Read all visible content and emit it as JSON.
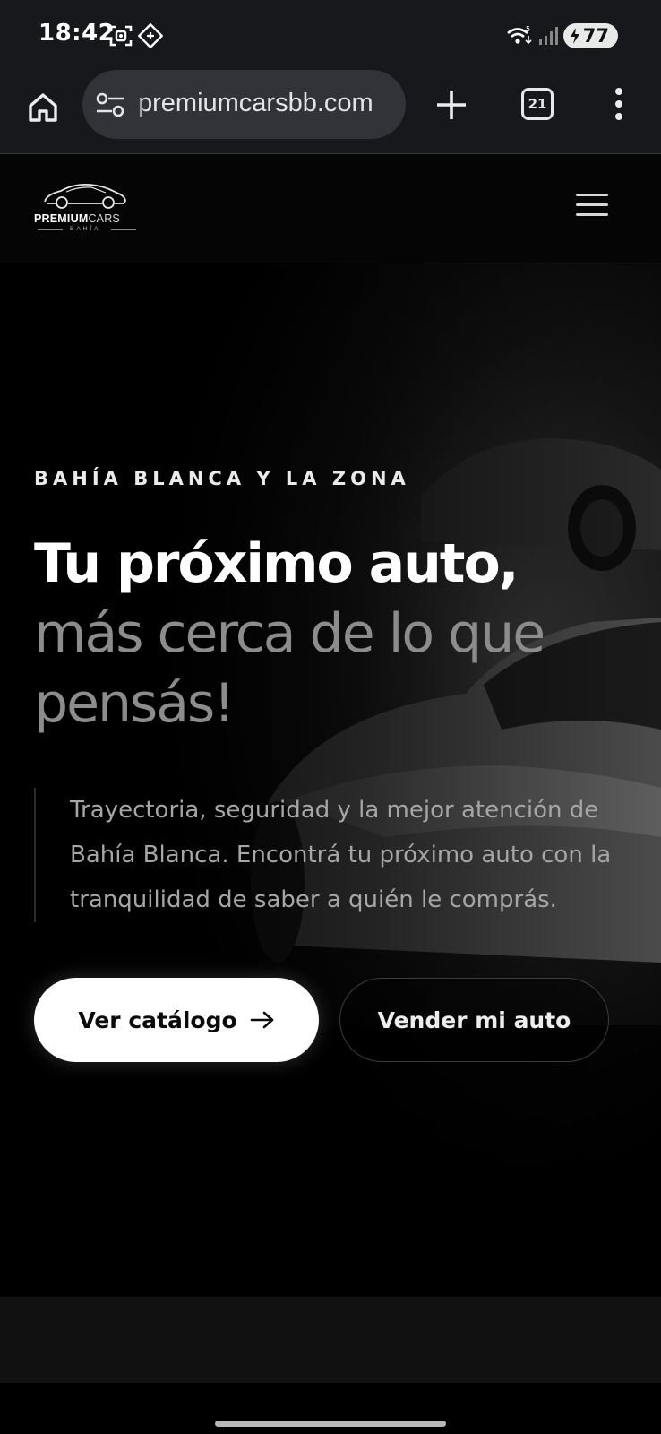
{
  "status_bar": {
    "time": "18:42",
    "battery": "77",
    "icons": [
      "screen-record-icon",
      "shortcut-diamond-icon",
      "wifi-icon",
      "signal-icon",
      "battery-charging-icon"
    ]
  },
  "browser": {
    "url": "premiumcarsbb.com",
    "tab_count": "21",
    "icons": [
      "home-icon",
      "site-settings-icon",
      "new-tab-plus-icon",
      "tabs-icon",
      "more-vert-icon"
    ]
  },
  "site": {
    "logo": {
      "word_bold": "PREMIUM",
      "word_light": "CARS",
      "sub": "BAHÍA"
    }
  },
  "hero": {
    "eyebrow": "BAHÍA BLANCA Y LA ZONA",
    "title_strong": "Tu próximo auto,",
    "title_soft": "más cerca de lo que pensás!",
    "description": "Trayectoria, seguridad y la mejor atención de Bahía Blanca. Encontrá tu próximo auto con la tranquilidad de saber a quién le comprás.",
    "primary_button": "Ver catálogo",
    "secondary_button": "Vender mi auto"
  },
  "colors": {
    "status_bg": "#17181c",
    "pill_bg": "#313338",
    "page_bg": "#000000",
    "title_soft": "#8c8c8c",
    "desc_text": "#a6a6a6"
  }
}
